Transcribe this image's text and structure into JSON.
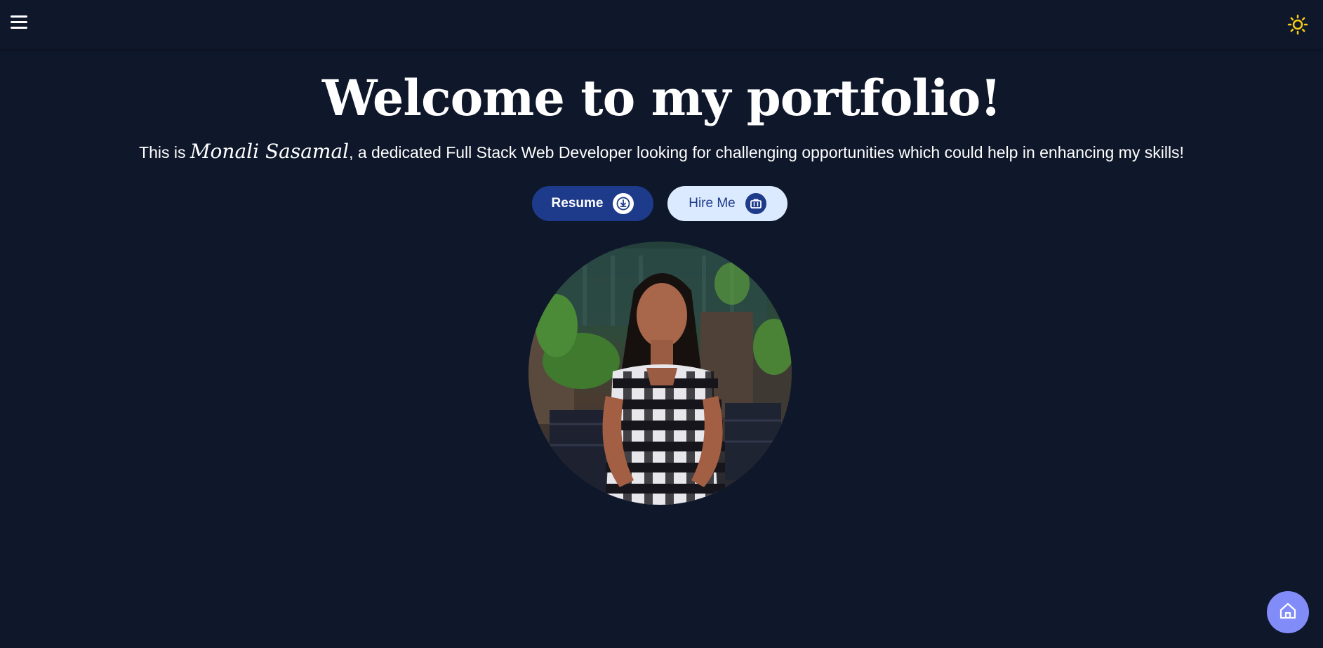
{
  "header": {
    "menu_icon": "hamburger-menu-icon",
    "theme_icon": "sun-icon",
    "theme_icon_color": "#facc15"
  },
  "hero": {
    "title": "Welcome to my portfolio!",
    "subtitle_prefix": "This is ",
    "name": "Monali Sasamal",
    "subtitle_suffix": ", a dedicated Full Stack Web Developer looking for challenging opportunities which could help in enhancing my skills!"
  },
  "actions": {
    "resume_label": "Resume",
    "resume_icon": "download-icon",
    "hire_label": "Hire Me",
    "hire_icon": "briefcase-icon"
  },
  "profile_photo": {
    "subject": "profile-photo"
  },
  "fab": {
    "icon": "home-icon",
    "color": "#818cf8"
  },
  "colors": {
    "background": "#0f172a",
    "primary": "#1e3a8a",
    "secondary": "#dbeafe",
    "accent": "#818cf8"
  }
}
